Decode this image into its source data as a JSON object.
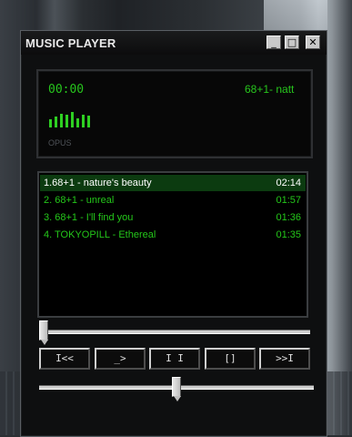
{
  "window": {
    "title": "MUSIC PLAYER",
    "min_label": "_",
    "max_label": "□",
    "close_label": "✕"
  },
  "display": {
    "time": "00:00",
    "marquee": "68+1- natt",
    "codec": "OPUS",
    "visualizer_levels": [
      0.55,
      0.7,
      0.9,
      0.85,
      1.0,
      0.6,
      0.85,
      0.75
    ]
  },
  "playlist": {
    "tracks": [
      {
        "name": "1.68+1 - nature's beauty",
        "duration": "02:14",
        "selected": true
      },
      {
        "name": "2. 68+1 - unreal",
        "duration": "01:57",
        "selected": false
      },
      {
        "name": "3. 68+1 - I'll find you",
        "duration": "01:36",
        "selected": false
      },
      {
        "name": "4. TOKYOPILL - Ethereal",
        "duration": "01:35",
        "selected": false
      }
    ]
  },
  "seek": {
    "position": 0.0
  },
  "controls": {
    "prev": "I<<",
    "play": "_>",
    "pause": "I I",
    "stop": "[]",
    "next": ">>I"
  },
  "volume": {
    "level": 0.5
  },
  "colors": {
    "accent_green": "#27c51d",
    "selected_row": "#0c3b10"
  }
}
